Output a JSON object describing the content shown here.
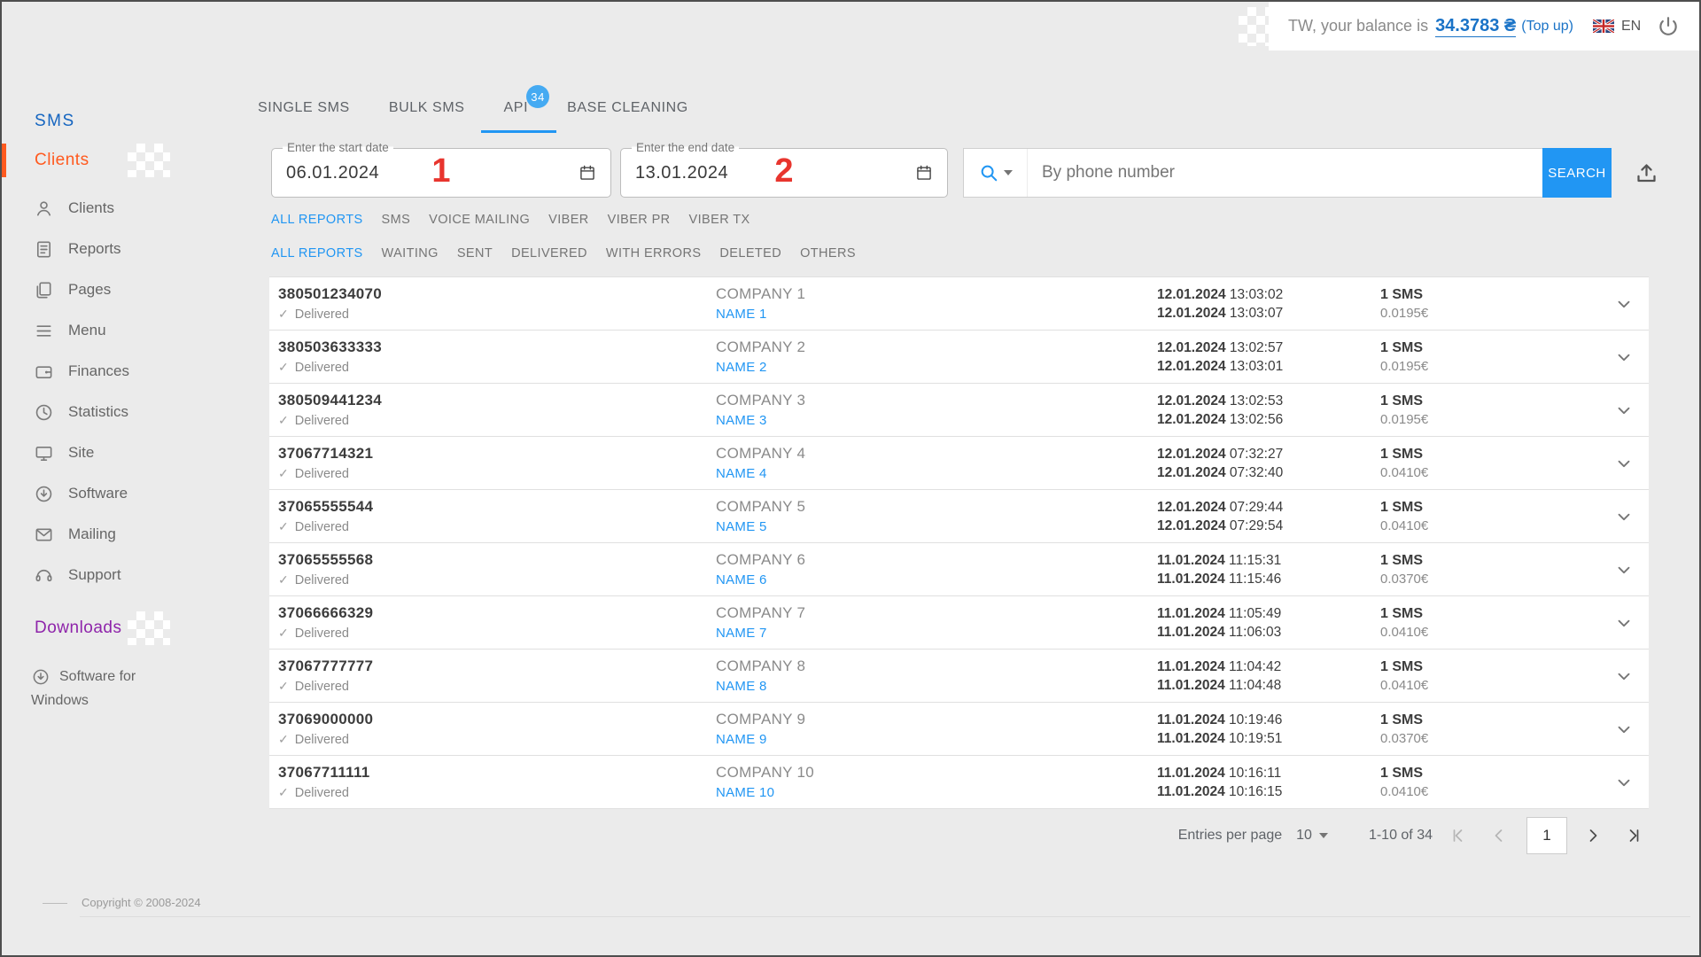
{
  "header": {
    "balance_prefix": "TW, your balance is",
    "balance_amount": "34.3783 ₴",
    "topup": "(Top up)",
    "lang": "EN"
  },
  "sidebar": {
    "sms_section": "SMS",
    "clients_section": "Clients",
    "items": [
      {
        "label": "Clients",
        "icon": "person-icon"
      },
      {
        "label": "Reports",
        "icon": "report-icon"
      },
      {
        "label": "Pages",
        "icon": "pages-icon"
      },
      {
        "label": "Menu",
        "icon": "menu-icon"
      },
      {
        "label": "Finances",
        "icon": "wallet-icon"
      },
      {
        "label": "Statistics",
        "icon": "clock-icon"
      },
      {
        "label": "Site",
        "icon": "monitor-icon"
      },
      {
        "label": "Software",
        "icon": "download-circle-icon"
      },
      {
        "label": "Mailing",
        "icon": "envelope-icon"
      },
      {
        "label": "Support",
        "icon": "headset-icon"
      }
    ],
    "downloads_section": "Downloads",
    "software_for_windows": "Software for Windows",
    "copyright": "Copyright © 2008-2024"
  },
  "tabs": [
    {
      "label": "SINGLE SMS",
      "active": false
    },
    {
      "label": "BULK SMS",
      "active": false
    },
    {
      "label": "API",
      "active": true,
      "badge": "34"
    },
    {
      "label": "BASE CLEANING",
      "active": false
    }
  ],
  "date_filters": {
    "start": {
      "label": "Enter the start date",
      "value": "06.01.2024",
      "annotation": "1"
    },
    "end": {
      "label": "Enter the end date",
      "value": "13.01.2024",
      "annotation": "2"
    }
  },
  "search": {
    "placeholder": "By phone number",
    "button_label": "SEARCH"
  },
  "report_type_filters": {
    "items": [
      {
        "label": "ALL REPORTS",
        "active": true
      },
      {
        "label": "SMS"
      },
      {
        "label": "VOICE MAILING"
      },
      {
        "label": "VIBER"
      },
      {
        "label": "VIBER PR"
      },
      {
        "label": "VIBER TX"
      }
    ]
  },
  "status_filters": {
    "items": [
      {
        "label": "ALL REPORTS",
        "active": true
      },
      {
        "label": "WAITING"
      },
      {
        "label": "SENT"
      },
      {
        "label": "DELIVERED"
      },
      {
        "label": "WITH ERRORS"
      },
      {
        "label": "DELETED"
      },
      {
        "label": "OTHERS"
      }
    ]
  },
  "table": {
    "rows": [
      {
        "phone": "380501234070",
        "status": "Delivered",
        "company": "COMPANY 1",
        "name": "NAME 1",
        "sent_date": "12.01.2024",
        "sent_time": "13:03:02",
        "delivered_date": "12.01.2024",
        "delivered_time": "13:03:07",
        "count": "1 SMS",
        "price": "0.0195€"
      },
      {
        "phone": "380503633333",
        "status": "Delivered",
        "company": "COMPANY 2",
        "name": "NAME 2",
        "sent_date": "12.01.2024",
        "sent_time": "13:02:57",
        "delivered_date": "12.01.2024",
        "delivered_time": "13:03:01",
        "count": "1 SMS",
        "price": "0.0195€"
      },
      {
        "phone": "380509441234",
        "status": "Delivered",
        "company": "COMPANY 3",
        "name": "NAME 3",
        "sent_date": "12.01.2024",
        "sent_time": "13:02:53",
        "delivered_date": "12.01.2024",
        "delivered_time": "13:02:56",
        "count": "1 SMS",
        "price": "0.0195€"
      },
      {
        "phone": "37067714321",
        "status": "Delivered",
        "company": "COMPANY 4",
        "name": "NAME 4",
        "sent_date": "12.01.2024",
        "sent_time": "07:32:27",
        "delivered_date": "12.01.2024",
        "delivered_time": "07:32:40",
        "count": "1 SMS",
        "price": "0.0410€"
      },
      {
        "phone": "37065555544",
        "status": "Delivered",
        "company": "COMPANY 5",
        "name": "NAME 5",
        "sent_date": "12.01.2024",
        "sent_time": "07:29:44",
        "delivered_date": "12.01.2024",
        "delivered_time": "07:29:54",
        "count": "1 SMS",
        "price": "0.0410€"
      },
      {
        "phone": "37065555568",
        "status": "Delivered",
        "company": "COMPANY 6",
        "name": "NAME 6",
        "sent_date": "11.01.2024",
        "sent_time": "11:15:31",
        "delivered_date": "11.01.2024",
        "delivered_time": "11:15:46",
        "count": "1 SMS",
        "price": "0.0370€"
      },
      {
        "phone": "37066666329",
        "status": "Delivered",
        "company": "COMPANY 7",
        "name": "NAME 7",
        "sent_date": "11.01.2024",
        "sent_time": "11:05:49",
        "delivered_date": "11.01.2024",
        "delivered_time": "11:06:03",
        "count": "1 SMS",
        "price": "0.0410€"
      },
      {
        "phone": "37067777777",
        "status": "Delivered",
        "company": "COMPANY 8",
        "name": "NAME 8",
        "sent_date": "11.01.2024",
        "sent_time": "11:04:42",
        "delivered_date": "11.01.2024",
        "delivered_time": "11:04:48",
        "count": "1 SMS",
        "price": "0.0410€"
      },
      {
        "phone": "37069000000",
        "status": "Delivered",
        "company": "COMPANY 9",
        "name": "NAME 9",
        "sent_date": "11.01.2024",
        "sent_time": "10:19:46",
        "delivered_date": "11.01.2024",
        "delivered_time": "10:19:51",
        "count": "1 SMS",
        "price": "0.0370€"
      },
      {
        "phone": "37067711111",
        "status": "Delivered",
        "company": "COMPANY 10",
        "name": "NAME 10",
        "sent_date": "11.01.2024",
        "sent_time": "10:16:11",
        "delivered_date": "11.01.2024",
        "delivered_time": "10:16:15",
        "count": "1 SMS",
        "price": "0.0410€"
      }
    ]
  },
  "pagination": {
    "entries_label": "Entries per page",
    "per_page": "10",
    "range": "1-10 of 34",
    "current_page": "1"
  }
}
